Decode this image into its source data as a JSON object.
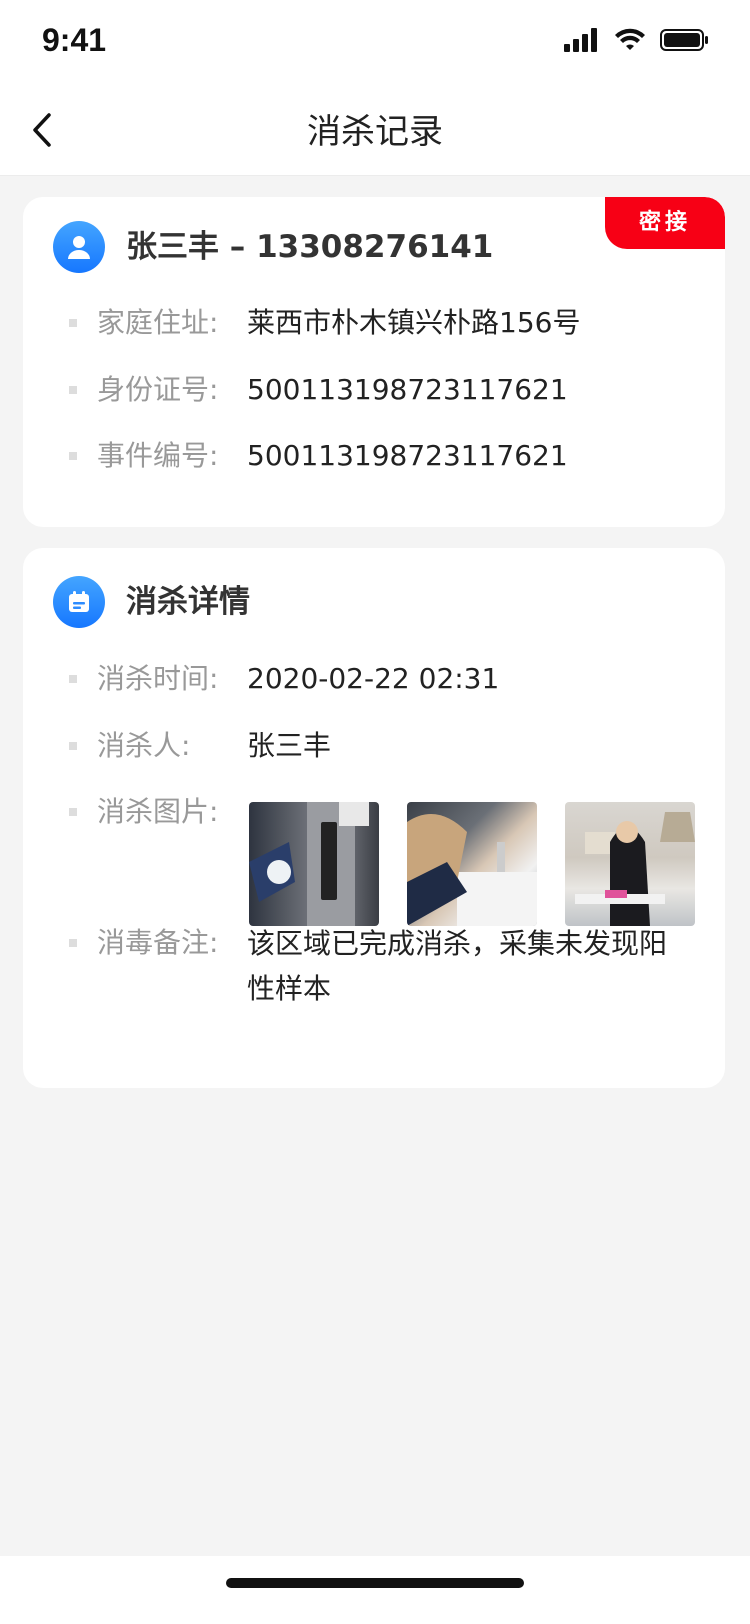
{
  "status_bar": {
    "time": "9:41",
    "icons": [
      "signal-icon",
      "wifi-icon",
      "battery-icon"
    ]
  },
  "nav": {
    "title": "消杀记录",
    "back_icon": "chevron-left-icon"
  },
  "person_card": {
    "badge": "密接",
    "icon": "user-icon",
    "title": "张三丰 – 13308276141",
    "rows": [
      {
        "label": "家庭住址:",
        "value": "莱西市朴木镇兴朴路156号"
      },
      {
        "label": "身份证号:",
        "value": "500113198723117621"
      },
      {
        "label": "事件编号:",
        "value": "500113198723117621"
      }
    ]
  },
  "detail_card": {
    "icon": "calendar-icon",
    "title": "消杀详情",
    "rows": [
      {
        "label": "消杀时间:",
        "value": "2020-02-22 02:31"
      },
      {
        "label": "消杀人:",
        "value": "张三丰"
      },
      {
        "label": "消杀图片:",
        "value": ""
      },
      {
        "label": "消毒备注:",
        "value": "该区域已完成消杀，采集未发现阳性样本"
      }
    ],
    "photos": [
      "elevator-disinfection-photo",
      "sink-disinfection-photo",
      "table-disinfection-photo"
    ]
  },
  "colors": {
    "accent": "#1677ff",
    "badge": "#f70015",
    "background": "#f4f4f4"
  }
}
